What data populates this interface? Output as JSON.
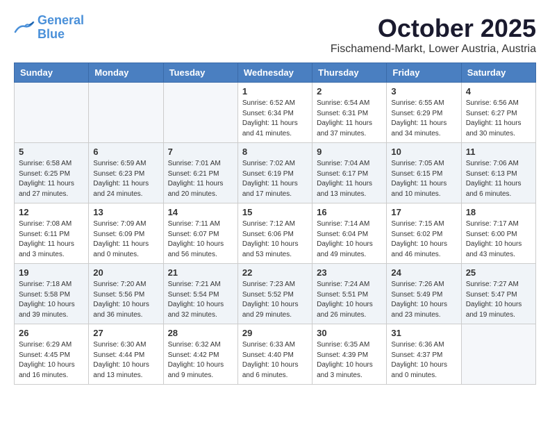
{
  "logo": {
    "line1": "General",
    "line2": "Blue"
  },
  "title": {
    "month_year": "October 2025",
    "location": "Fischamend-Markt, Lower Austria, Austria"
  },
  "weekdays": [
    "Sunday",
    "Monday",
    "Tuesday",
    "Wednesday",
    "Thursday",
    "Friday",
    "Saturday"
  ],
  "weeks": [
    [
      {
        "day": "",
        "info": ""
      },
      {
        "day": "",
        "info": ""
      },
      {
        "day": "",
        "info": ""
      },
      {
        "day": "1",
        "info": "Sunrise: 6:52 AM\nSunset: 6:34 PM\nDaylight: 11 hours\nand 41 minutes."
      },
      {
        "day": "2",
        "info": "Sunrise: 6:54 AM\nSunset: 6:31 PM\nDaylight: 11 hours\nand 37 minutes."
      },
      {
        "day": "3",
        "info": "Sunrise: 6:55 AM\nSunset: 6:29 PM\nDaylight: 11 hours\nand 34 minutes."
      },
      {
        "day": "4",
        "info": "Sunrise: 6:56 AM\nSunset: 6:27 PM\nDaylight: 11 hours\nand 30 minutes."
      }
    ],
    [
      {
        "day": "5",
        "info": "Sunrise: 6:58 AM\nSunset: 6:25 PM\nDaylight: 11 hours\nand 27 minutes."
      },
      {
        "day": "6",
        "info": "Sunrise: 6:59 AM\nSunset: 6:23 PM\nDaylight: 11 hours\nand 24 minutes."
      },
      {
        "day": "7",
        "info": "Sunrise: 7:01 AM\nSunset: 6:21 PM\nDaylight: 11 hours\nand 20 minutes."
      },
      {
        "day": "8",
        "info": "Sunrise: 7:02 AM\nSunset: 6:19 PM\nDaylight: 11 hours\nand 17 minutes."
      },
      {
        "day": "9",
        "info": "Sunrise: 7:04 AM\nSunset: 6:17 PM\nDaylight: 11 hours\nand 13 minutes."
      },
      {
        "day": "10",
        "info": "Sunrise: 7:05 AM\nSunset: 6:15 PM\nDaylight: 11 hours\nand 10 minutes."
      },
      {
        "day": "11",
        "info": "Sunrise: 7:06 AM\nSunset: 6:13 PM\nDaylight: 11 hours\nand 6 minutes."
      }
    ],
    [
      {
        "day": "12",
        "info": "Sunrise: 7:08 AM\nSunset: 6:11 PM\nDaylight: 11 hours\nand 3 minutes."
      },
      {
        "day": "13",
        "info": "Sunrise: 7:09 AM\nSunset: 6:09 PM\nDaylight: 11 hours\nand 0 minutes."
      },
      {
        "day": "14",
        "info": "Sunrise: 7:11 AM\nSunset: 6:07 PM\nDaylight: 10 hours\nand 56 minutes."
      },
      {
        "day": "15",
        "info": "Sunrise: 7:12 AM\nSunset: 6:06 PM\nDaylight: 10 hours\nand 53 minutes."
      },
      {
        "day": "16",
        "info": "Sunrise: 7:14 AM\nSunset: 6:04 PM\nDaylight: 10 hours\nand 49 minutes."
      },
      {
        "day": "17",
        "info": "Sunrise: 7:15 AM\nSunset: 6:02 PM\nDaylight: 10 hours\nand 46 minutes."
      },
      {
        "day": "18",
        "info": "Sunrise: 7:17 AM\nSunset: 6:00 PM\nDaylight: 10 hours\nand 43 minutes."
      }
    ],
    [
      {
        "day": "19",
        "info": "Sunrise: 7:18 AM\nSunset: 5:58 PM\nDaylight: 10 hours\nand 39 minutes."
      },
      {
        "day": "20",
        "info": "Sunrise: 7:20 AM\nSunset: 5:56 PM\nDaylight: 10 hours\nand 36 minutes."
      },
      {
        "day": "21",
        "info": "Sunrise: 7:21 AM\nSunset: 5:54 PM\nDaylight: 10 hours\nand 32 minutes."
      },
      {
        "day": "22",
        "info": "Sunrise: 7:23 AM\nSunset: 5:52 PM\nDaylight: 10 hours\nand 29 minutes."
      },
      {
        "day": "23",
        "info": "Sunrise: 7:24 AM\nSunset: 5:51 PM\nDaylight: 10 hours\nand 26 minutes."
      },
      {
        "day": "24",
        "info": "Sunrise: 7:26 AM\nSunset: 5:49 PM\nDaylight: 10 hours\nand 23 minutes."
      },
      {
        "day": "25",
        "info": "Sunrise: 7:27 AM\nSunset: 5:47 PM\nDaylight: 10 hours\nand 19 minutes."
      }
    ],
    [
      {
        "day": "26",
        "info": "Sunrise: 6:29 AM\nSunset: 4:45 PM\nDaylight: 10 hours\nand 16 minutes."
      },
      {
        "day": "27",
        "info": "Sunrise: 6:30 AM\nSunset: 4:44 PM\nDaylight: 10 hours\nand 13 minutes."
      },
      {
        "day": "28",
        "info": "Sunrise: 6:32 AM\nSunset: 4:42 PM\nDaylight: 10 hours\nand 9 minutes."
      },
      {
        "day": "29",
        "info": "Sunrise: 6:33 AM\nSunset: 4:40 PM\nDaylight: 10 hours\nand 6 minutes."
      },
      {
        "day": "30",
        "info": "Sunrise: 6:35 AM\nSunset: 4:39 PM\nDaylight: 10 hours\nand 3 minutes."
      },
      {
        "day": "31",
        "info": "Sunrise: 6:36 AM\nSunset: 4:37 PM\nDaylight: 10 hours\nand 0 minutes."
      },
      {
        "day": "",
        "info": ""
      }
    ]
  ]
}
